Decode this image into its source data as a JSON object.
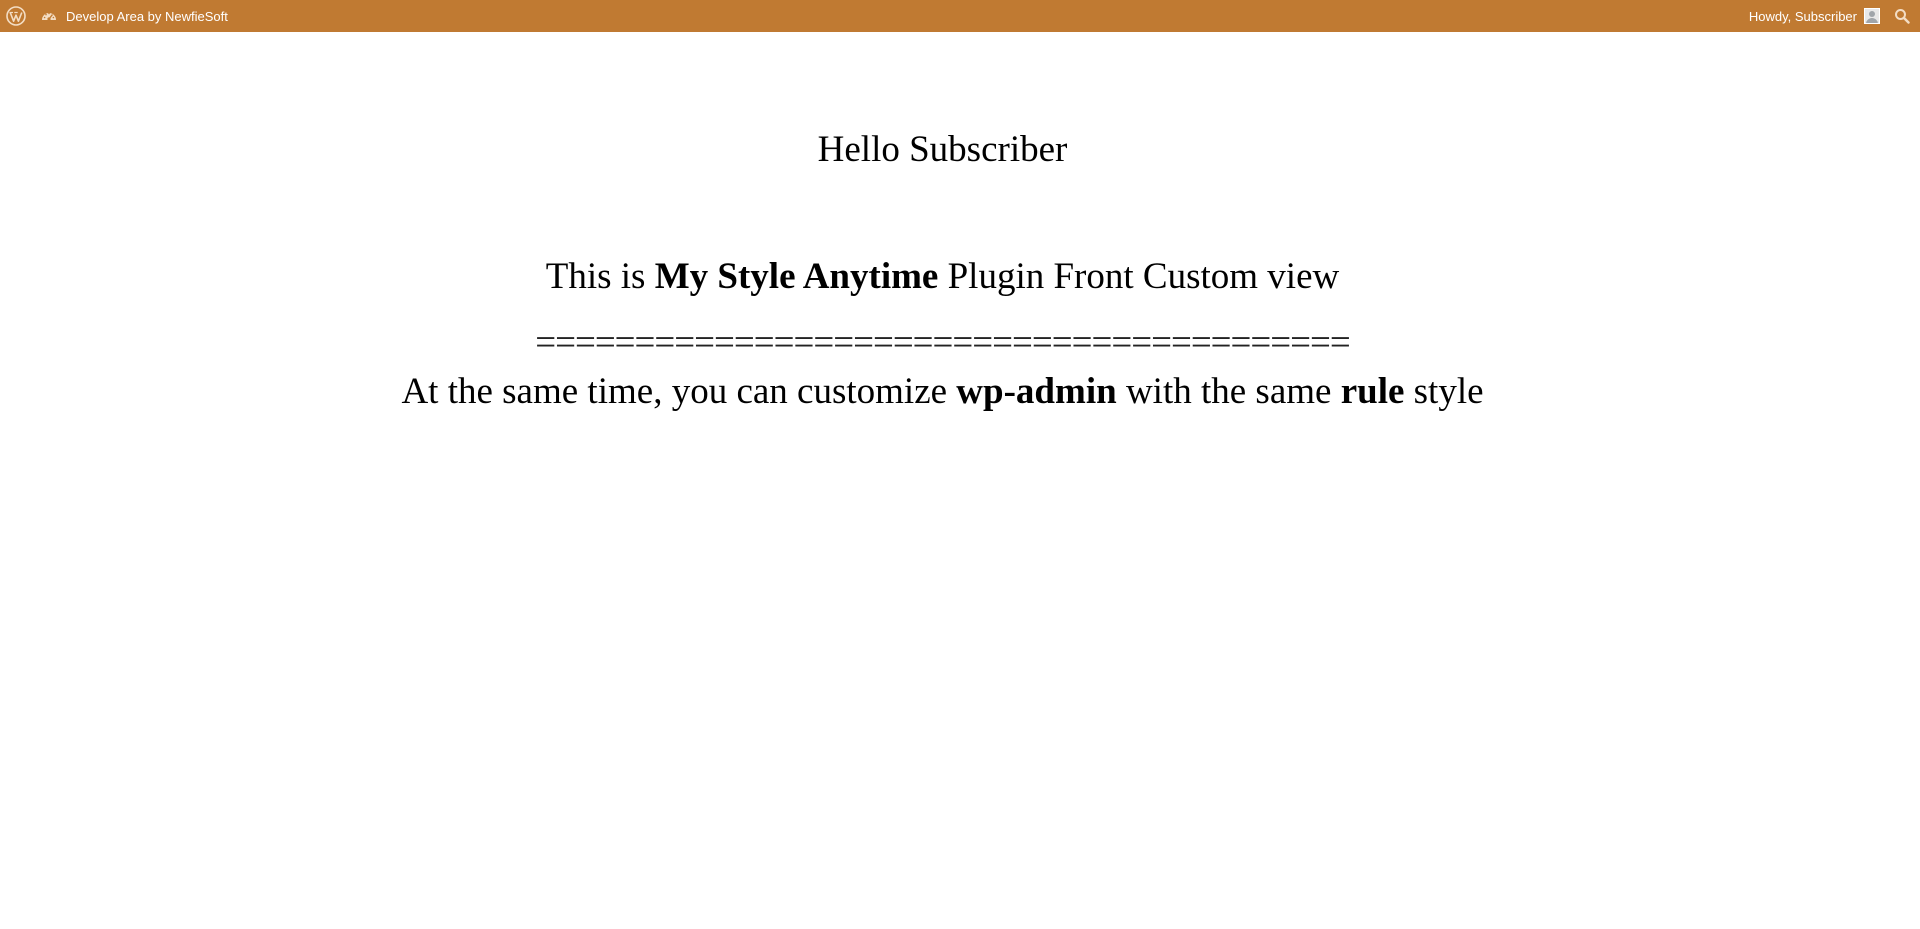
{
  "adminbar": {
    "logo_icon": "wordpress-icon",
    "site_icon": "dashboard-icon",
    "site_name": "Develop Area by NewfieSoft",
    "greeting": "Howdy, Subscriber",
    "avatar_icon": "user-avatar-icon",
    "search_icon": "search-icon",
    "bar_color": "#c07a32"
  },
  "main": {
    "hello": "Hello Subscriber",
    "line1": {
      "pre": "This is ",
      "bold": "My Style Anytime",
      "post": " Plugin Front Custom view"
    },
    "divider": "=========================================",
    "line2": {
      "pre": "At the same time, you can customize ",
      "bold1": "wp-admin",
      "mid": " with the same ",
      "bold2": "rule",
      "post": " style"
    }
  }
}
